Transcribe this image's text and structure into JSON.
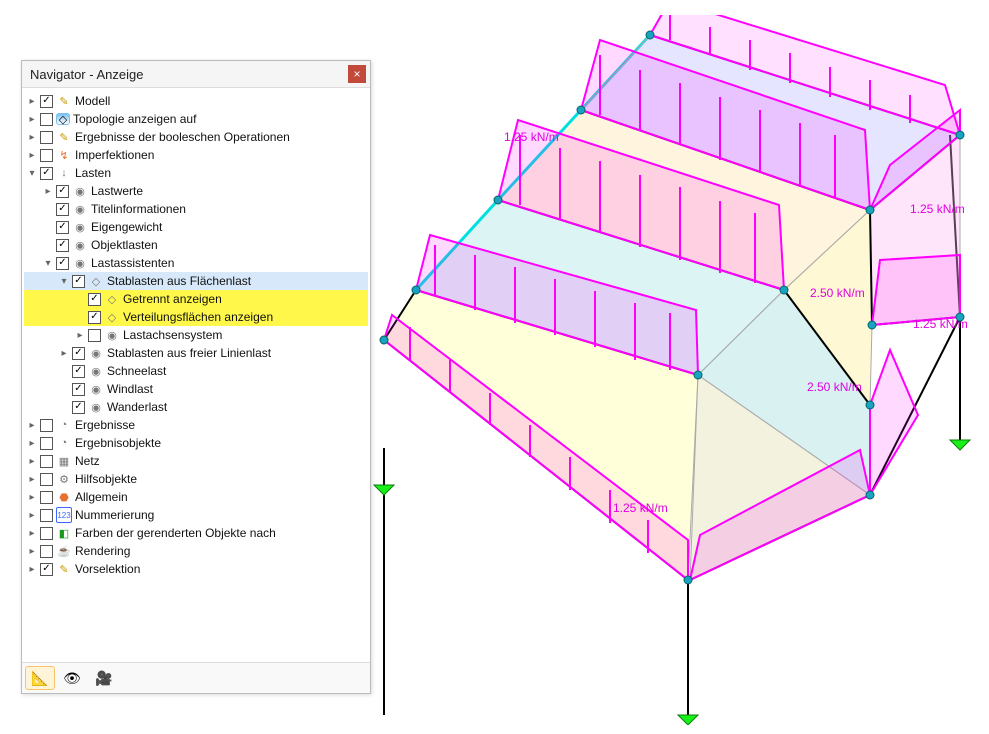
{
  "panel": {
    "title": "Navigator - Anzeige"
  },
  "tree": [
    {
      "d": 0,
      "a": "r",
      "c": true,
      "icon": "✎",
      "iclass": "ic-pencil",
      "label": "Modell"
    },
    {
      "d": 0,
      "a": "r",
      "c": false,
      "icon": "◇",
      "iclass": "ic-eye",
      "label": "Topologie anzeigen auf"
    },
    {
      "d": 0,
      "a": "r",
      "c": false,
      "icon": "✎",
      "iclass": "ic-pencil",
      "label": "Ergebnisse der booleschen Operationen"
    },
    {
      "d": 0,
      "a": "r",
      "c": false,
      "icon": "↯",
      "iclass": "ic-orange",
      "label": "Imperfektionen"
    },
    {
      "d": 0,
      "a": "d",
      "c": true,
      "icon": "↓",
      "iclass": "ic-gen",
      "label": "Lasten"
    },
    {
      "d": 1,
      "a": "r",
      "c": true,
      "icon": "◉",
      "iclass": "ic-gen",
      "label": "Lastwerte"
    },
    {
      "d": 1,
      "a": "",
      "c": true,
      "icon": "◉",
      "iclass": "ic-gen",
      "label": "Titelinformationen"
    },
    {
      "d": 1,
      "a": "",
      "c": true,
      "icon": "◉",
      "iclass": "ic-gen",
      "label": "Eigengewicht"
    },
    {
      "d": 1,
      "a": "",
      "c": true,
      "icon": "◉",
      "iclass": "ic-gen",
      "label": "Objektlasten"
    },
    {
      "d": 1,
      "a": "d",
      "c": true,
      "icon": "◉",
      "iclass": "ic-gen",
      "label": "Lastassistenten"
    },
    {
      "d": 2,
      "a": "d",
      "c": true,
      "icon": "◇",
      "iclass": "ic-gen",
      "label": "Stablasten aus Flächenlast",
      "sel": true
    },
    {
      "d": 3,
      "a": "",
      "c": true,
      "icon": "◇",
      "iclass": "ic-gen",
      "label": "Getrennt anzeigen",
      "hl": true
    },
    {
      "d": 3,
      "a": "",
      "c": true,
      "icon": "◇",
      "iclass": "ic-gen",
      "label": "Verteilungsflächen anzeigen",
      "hl": true
    },
    {
      "d": 3,
      "a": "r",
      "c": false,
      "icon": "◉",
      "iclass": "ic-gen",
      "label": "Lastachsensystem"
    },
    {
      "d": 2,
      "a": "r",
      "c": true,
      "icon": "◉",
      "iclass": "ic-gen",
      "label": "Stablasten aus freier Linienlast"
    },
    {
      "d": 2,
      "a": "",
      "c": true,
      "icon": "◉",
      "iclass": "ic-gen",
      "label": "Schneelast"
    },
    {
      "d": 2,
      "a": "",
      "c": true,
      "icon": "◉",
      "iclass": "ic-gen",
      "label": "Windlast"
    },
    {
      "d": 2,
      "a": "",
      "c": true,
      "icon": "◉",
      "iclass": "ic-gen",
      "label": "Wanderlast"
    },
    {
      "d": 0,
      "a": "r",
      "c": false,
      "icon": "◔",
      "iclass": "ic-gen",
      "label": "Ergebnisse"
    },
    {
      "d": 0,
      "a": "r",
      "c": false,
      "icon": "◔",
      "iclass": "ic-gen",
      "label": "Ergebnisobjekte"
    },
    {
      "d": 0,
      "a": "r",
      "c": false,
      "icon": "▦",
      "iclass": "ic-gen",
      "label": "Netz"
    },
    {
      "d": 0,
      "a": "r",
      "c": false,
      "icon": "⚙",
      "iclass": "ic-gen",
      "label": "Hilfsobjekte"
    },
    {
      "d": 0,
      "a": "r",
      "c": false,
      "icon": "⬣",
      "iclass": "ic-orange",
      "label": "Allgemein"
    },
    {
      "d": 0,
      "a": "r",
      "c": false,
      "icon": "123",
      "iclass": "ic-num",
      "label": "Nummerierung"
    },
    {
      "d": 0,
      "a": "r",
      "c": false,
      "icon": "◧",
      "iclass": "ic-green",
      "label": "Farben der gerenderten Objekte nach"
    },
    {
      "d": 0,
      "a": "r",
      "c": false,
      "icon": "☕",
      "iclass": "ic-teapot",
      "label": "Rendering"
    },
    {
      "d": 0,
      "a": "r",
      "c": true,
      "icon": "✎",
      "iclass": "ic-pencil",
      "label": "Vorselektion"
    }
  ],
  "annotations": {
    "a1": "1.25 kN/m",
    "a2": "1.25 kN/m",
    "a3": "1.25 kN/m",
    "a4": "2.50 kN/m",
    "a5": "2.50 kN/m",
    "a6": "1.25 kN/m"
  }
}
